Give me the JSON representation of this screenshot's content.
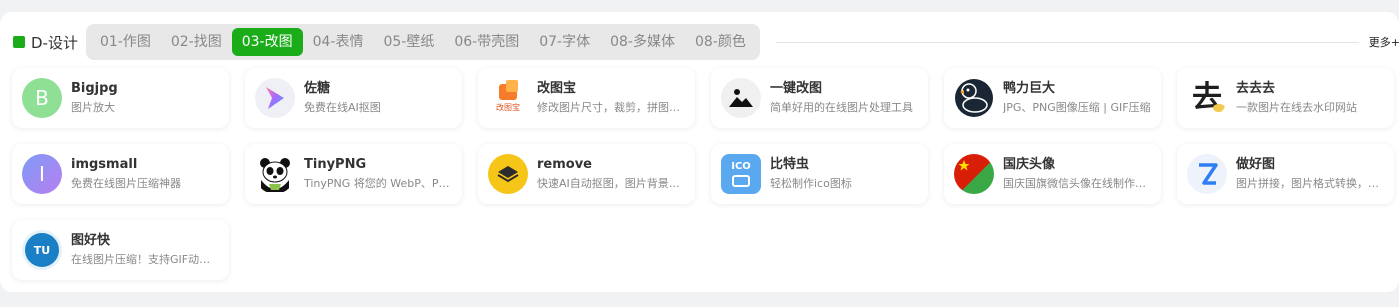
{
  "category": {
    "title": "D-设计",
    "accent": "#1aad19"
  },
  "tabs": [
    {
      "label": "01-作图"
    },
    {
      "label": "02-找图"
    },
    {
      "label": "03-改图",
      "active": true
    },
    {
      "label": "04-表情"
    },
    {
      "label": "05-壁纸"
    },
    {
      "label": "06-带壳图"
    },
    {
      "label": "07-字体"
    },
    {
      "label": "08-多媒体"
    },
    {
      "label": "08-颜色"
    }
  ],
  "more_label": "更多+",
  "cards": [
    {
      "name": "Bigjpg",
      "desc": "图片放大",
      "icon": "bigjpg-icon",
      "letter": "B"
    },
    {
      "name": "佐糖",
      "desc": "免费在线AI抠图",
      "icon": "zuotang-icon"
    },
    {
      "name": "改图宝",
      "desc": "修改图片尺寸，裁剪，拼图，压缩",
      "icon": "gaitubao-icon",
      "icon_text": "改图宝"
    },
    {
      "name": "一键改图",
      "desc": "简单好用的在线图片处理工具",
      "icon": "image-mountain-icon"
    },
    {
      "name": "鸭力巨大",
      "desc": "JPG、PNG图像压缩 | GIF压缩",
      "icon": "duck-icon"
    },
    {
      "name": "去去去",
      "desc": "一款图片在线去水印网站",
      "icon": "qu-icon",
      "icon_text": "去"
    },
    {
      "name": "imgsmall",
      "desc": "免费在线图片压缩神器",
      "icon": "imgsmall-icon",
      "letter": "I"
    },
    {
      "name": "TinyPNG",
      "desc": "TinyPNG 将您的 WebP、PNG 和 JPEG",
      "icon": "panda-icon"
    },
    {
      "name": "remove",
      "desc": "快速AI自动抠图，图片背景消除",
      "icon": "layers-icon"
    },
    {
      "name": "比特虫",
      "desc": "轻松制作ico图标",
      "icon": "ico-icon",
      "icon_text": "ICO"
    },
    {
      "name": "国庆头像",
      "desc": "国庆国旗微信头像在线制作生成",
      "icon": "flag-avatar-icon"
    },
    {
      "name": "做好图",
      "desc": "图片拼接，图片格式转换，图片压缩",
      "icon": "zuohaotu-icon"
    },
    {
      "name": "图好快",
      "desc": "在线图片压缩！支持GIF动态图",
      "icon": "tuhaokuai-icon",
      "icon_text": "TU"
    }
  ]
}
